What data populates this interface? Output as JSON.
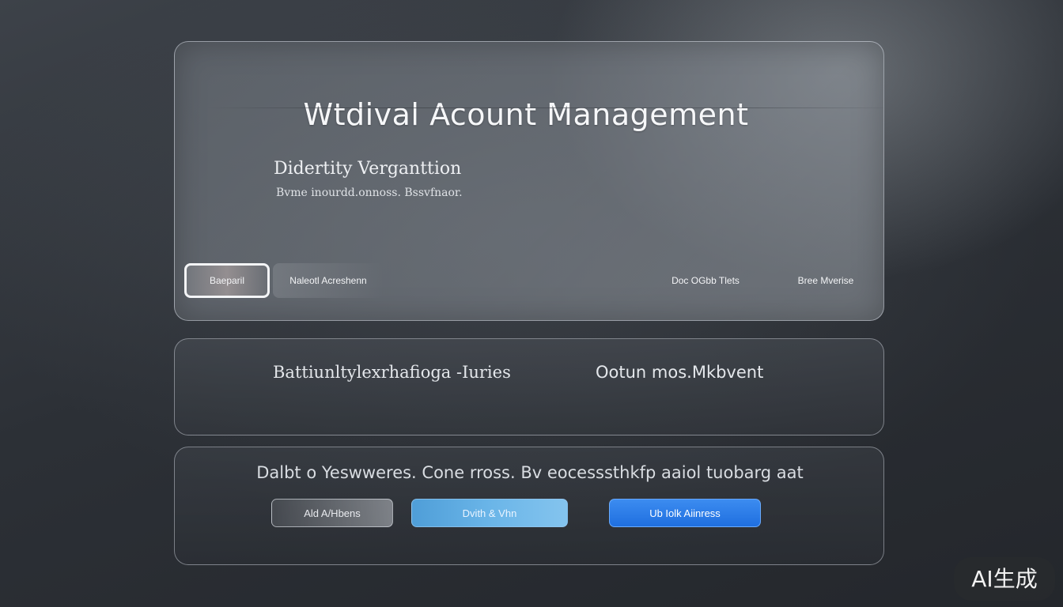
{
  "header": {
    "title": "Wtdival Acount Management"
  },
  "section": {
    "heading": "Didertity Verganttion",
    "subtext": "Bvme inourdd.onnoss. Bssvfnaor."
  },
  "tabs": [
    {
      "label": "Baeparil",
      "active": true
    },
    {
      "label": "Naleotl Acreshenn",
      "active": false
    },
    {
      "label": "Doc OGbb Tlets",
      "active": false
    },
    {
      "label": "Bree Mverise",
      "active": false
    }
  ],
  "middle": {
    "left_text": "Battiunltylexrhafioga -Iuries",
    "right_text": "Ootun mos.Mkbvent"
  },
  "bottom": {
    "text": "Dalbt o Yeswweres. Cone rross. Bv eocesssthkfp aaiol tuobarg aat",
    "buttons": [
      {
        "label": "Ald A/Hbens"
      },
      {
        "label": "Dvith & Vhn"
      },
      {
        "label": "Ub Iolk Aiinress"
      }
    ]
  },
  "badge": {
    "label": "AI生成"
  },
  "colors": {
    "accent_blue": "#1f6fe0",
    "light_blue": "#6ab5e8"
  }
}
